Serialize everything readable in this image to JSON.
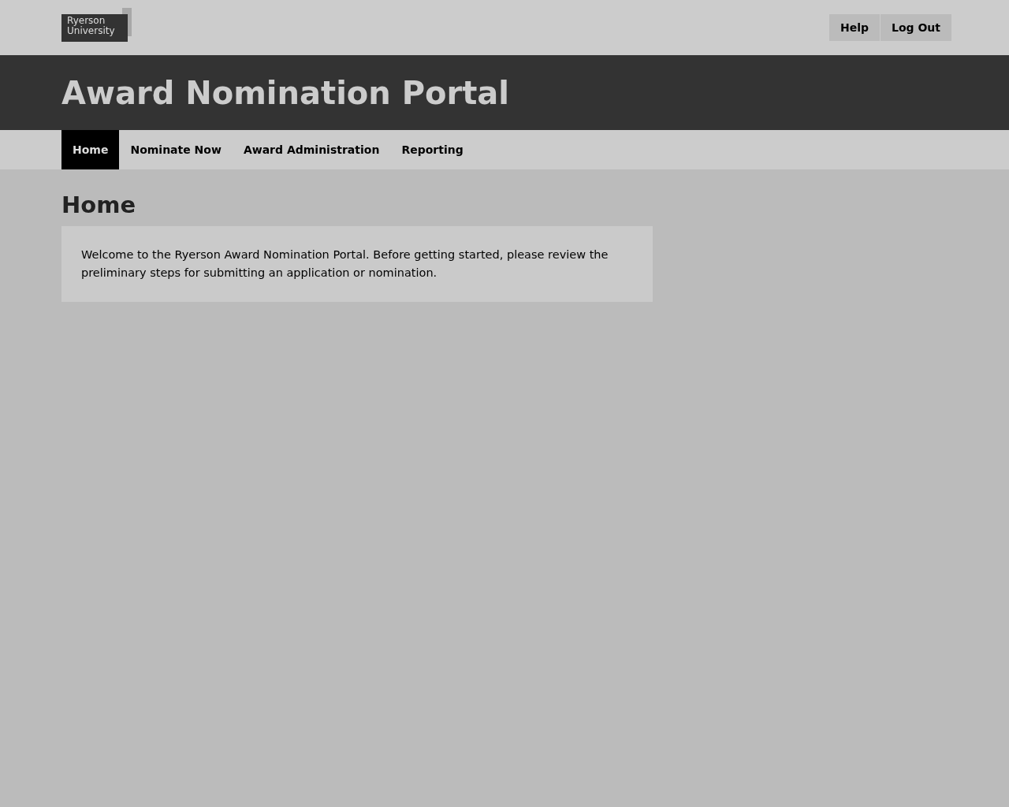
{
  "logo": {
    "line_1": "Ryerson",
    "line_2": "University"
  },
  "header_buttons": [
    "Help",
    "Log Out"
  ],
  "banner": {
    "title": "Award Nomination Portal"
  },
  "nav": [
    {
      "label": "Home",
      "selected": true
    },
    {
      "label": "Nominate Now",
      "selected": false
    },
    {
      "label": "Award Administration",
      "selected": false
    },
    {
      "label": "Reporting",
      "selected": false
    }
  ],
  "page": {
    "heading": "Home",
    "welcome": "Welcome to the Ryerson Award Nomination Portal. Before getting started, please review the preliminary steps for submitting an application or nomination."
  }
}
